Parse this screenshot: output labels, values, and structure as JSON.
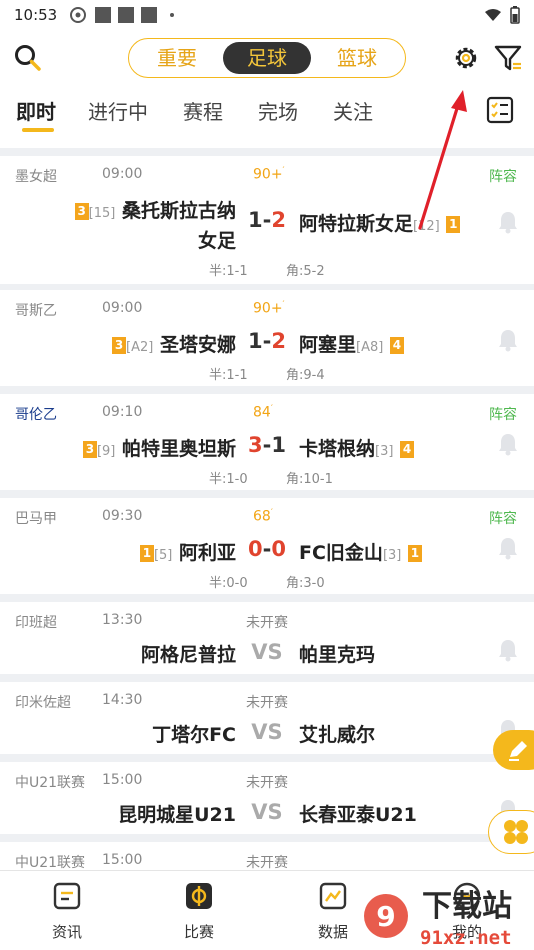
{
  "status": {
    "time": "10:53"
  },
  "header": {
    "segments": [
      "重要",
      "足球",
      "篮球"
    ],
    "active_segment": 1,
    "icons": {
      "search": "search-icon",
      "settings": "gear-icon",
      "filter": "filter-icon"
    }
  },
  "tabs": {
    "items": [
      "即时",
      "进行中",
      "赛程",
      "完场",
      "关注"
    ],
    "active": 0
  },
  "matches": [
    {
      "league": "墨女超",
      "time": "09:00",
      "minute": "90+",
      "lineup": "阵容",
      "home_badge": "3",
      "home_rank": "[15]",
      "home": "桑托斯拉古纳",
      "home_line2": "女足",
      "score_h": "1",
      "score_a": "2",
      "away": "阿特拉斯女足",
      "away_rank": "[12]",
      "away_badge": "1",
      "half": "半:1-1",
      "corner": "角:5-2"
    },
    {
      "league": "哥斯乙",
      "time": "09:00",
      "minute": "90+",
      "home_badge": "3",
      "home_rank": "[A2]",
      "home": "圣塔安娜",
      "score_h": "1",
      "score_a": "2",
      "away": "阿塞里",
      "away_rank": "[A8]",
      "away_badge": "4",
      "half": "半:1-1",
      "corner": "角:9-4"
    },
    {
      "league": "哥伦乙",
      "time": "09:10",
      "minute": "84",
      "lineup": "阵容",
      "home_badge": "3",
      "home_rank": "[9]",
      "home": "帕特里奥坦斯",
      "score_h": "3",
      "score_a": "1",
      "away": "卡塔根纳",
      "away_rank": "[3]",
      "away_badge": "4",
      "half": "半:1-0",
      "corner": "角:10-1"
    },
    {
      "league": "巴马甲",
      "time": "09:30",
      "minute": "68",
      "lineup": "阵容",
      "home_badge": "1",
      "home_rank": "[5]",
      "home": "阿利亚",
      "score_h": "0",
      "score_a": "0",
      "away": "FC旧金山",
      "away_rank": "[3]",
      "away_badge": "1",
      "half": "半:0-0",
      "corner": "角:3-0"
    },
    {
      "league": "印班超",
      "time": "13:30",
      "minute": "未开赛",
      "home": "阿格尼普拉",
      "vs": "VS",
      "away": "帕里克玛"
    },
    {
      "league": "印米佐超",
      "time": "14:30",
      "minute": "未开赛",
      "home": "丁塔尔FC",
      "vs": "VS",
      "away": "艾扎威尔"
    },
    {
      "league": "中U21联赛",
      "time": "15:00",
      "minute": "未开赛",
      "home": "昆明城星U21",
      "vs": "VS",
      "away": "长春亚泰U21"
    },
    {
      "league": "中U21联赛",
      "time": "15:00",
      "minute": "未开赛"
    }
  ],
  "bottom_nav": [
    {
      "label": "资讯",
      "icon": "news-icon"
    },
    {
      "label": "比赛",
      "icon": "match-icon"
    },
    {
      "label": "数据",
      "icon": "data-chart-icon"
    },
    {
      "label": "我的",
      "icon": "profile-icon"
    }
  ],
  "watermark": {
    "main": "下载站",
    "sub": "91xz.net"
  },
  "colors": {
    "accent": "#f4b81c",
    "live_score": "#e0442e",
    "lineup": "#4fb84f"
  }
}
